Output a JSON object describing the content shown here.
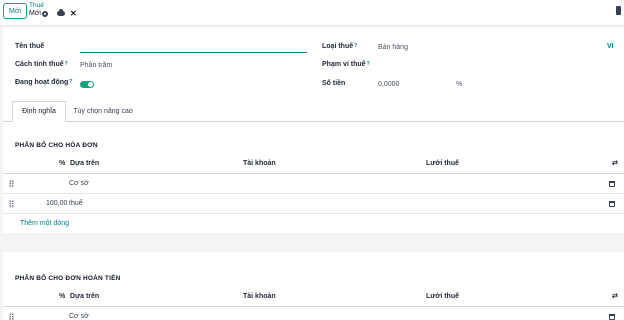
{
  "toolbar": {
    "new_label": "Mới",
    "breadcrumb_parent": "Thuế",
    "breadcrumb_current": "Mới"
  },
  "form": {
    "tax_name_label": "Tên thuế",
    "tax_type_label": "Loại thuế",
    "tax_type_value": "Bán hàng",
    "language_code": "VI",
    "computation_label": "Cách tính thuế",
    "computation_value": "Phần trăm",
    "tax_scope_label": "Phạm vi thuế",
    "active_label": "Đang hoạt động",
    "active": true,
    "amount_label": "Số tiền",
    "amount_value": "0,0000",
    "amount_unit": "%",
    "help_mark": "?"
  },
  "tabs": [
    {
      "label": "Định nghĩa"
    },
    {
      "label": "Tùy chọn nâng cao"
    }
  ],
  "invoice_section": {
    "title": "PHÂN BỔ CHO HÓA ĐƠN",
    "columns": {
      "percent": "%",
      "based_on": "Dựa trên",
      "account": "Tài khoản",
      "tax_grid": "Lưới thuế"
    },
    "rows": [
      {
        "percent": "",
        "based_on": "Cơ sở"
      },
      {
        "percent": "100,00",
        "based_on": "thuế"
      }
    ],
    "add_line": "Thêm một dòng"
  },
  "refund_section": {
    "title": "PHÂN BỔ CHO ĐƠN HOÀN TIỀN",
    "columns": {
      "percent": "%",
      "based_on": "Dựa trên",
      "account": "Tài khoản",
      "tax_grid": "Lưới thuế"
    },
    "rows": [
      {
        "percent": "",
        "based_on": "Cơ sở"
      }
    ]
  },
  "colors": {
    "accent": "#017e84",
    "toggle_on": "#10a37f"
  },
  "icons": [
    "gear-icon",
    "cloud-upload-icon",
    "close-icon",
    "swap-icon",
    "trash-icon",
    "drag-handle-icon"
  ]
}
